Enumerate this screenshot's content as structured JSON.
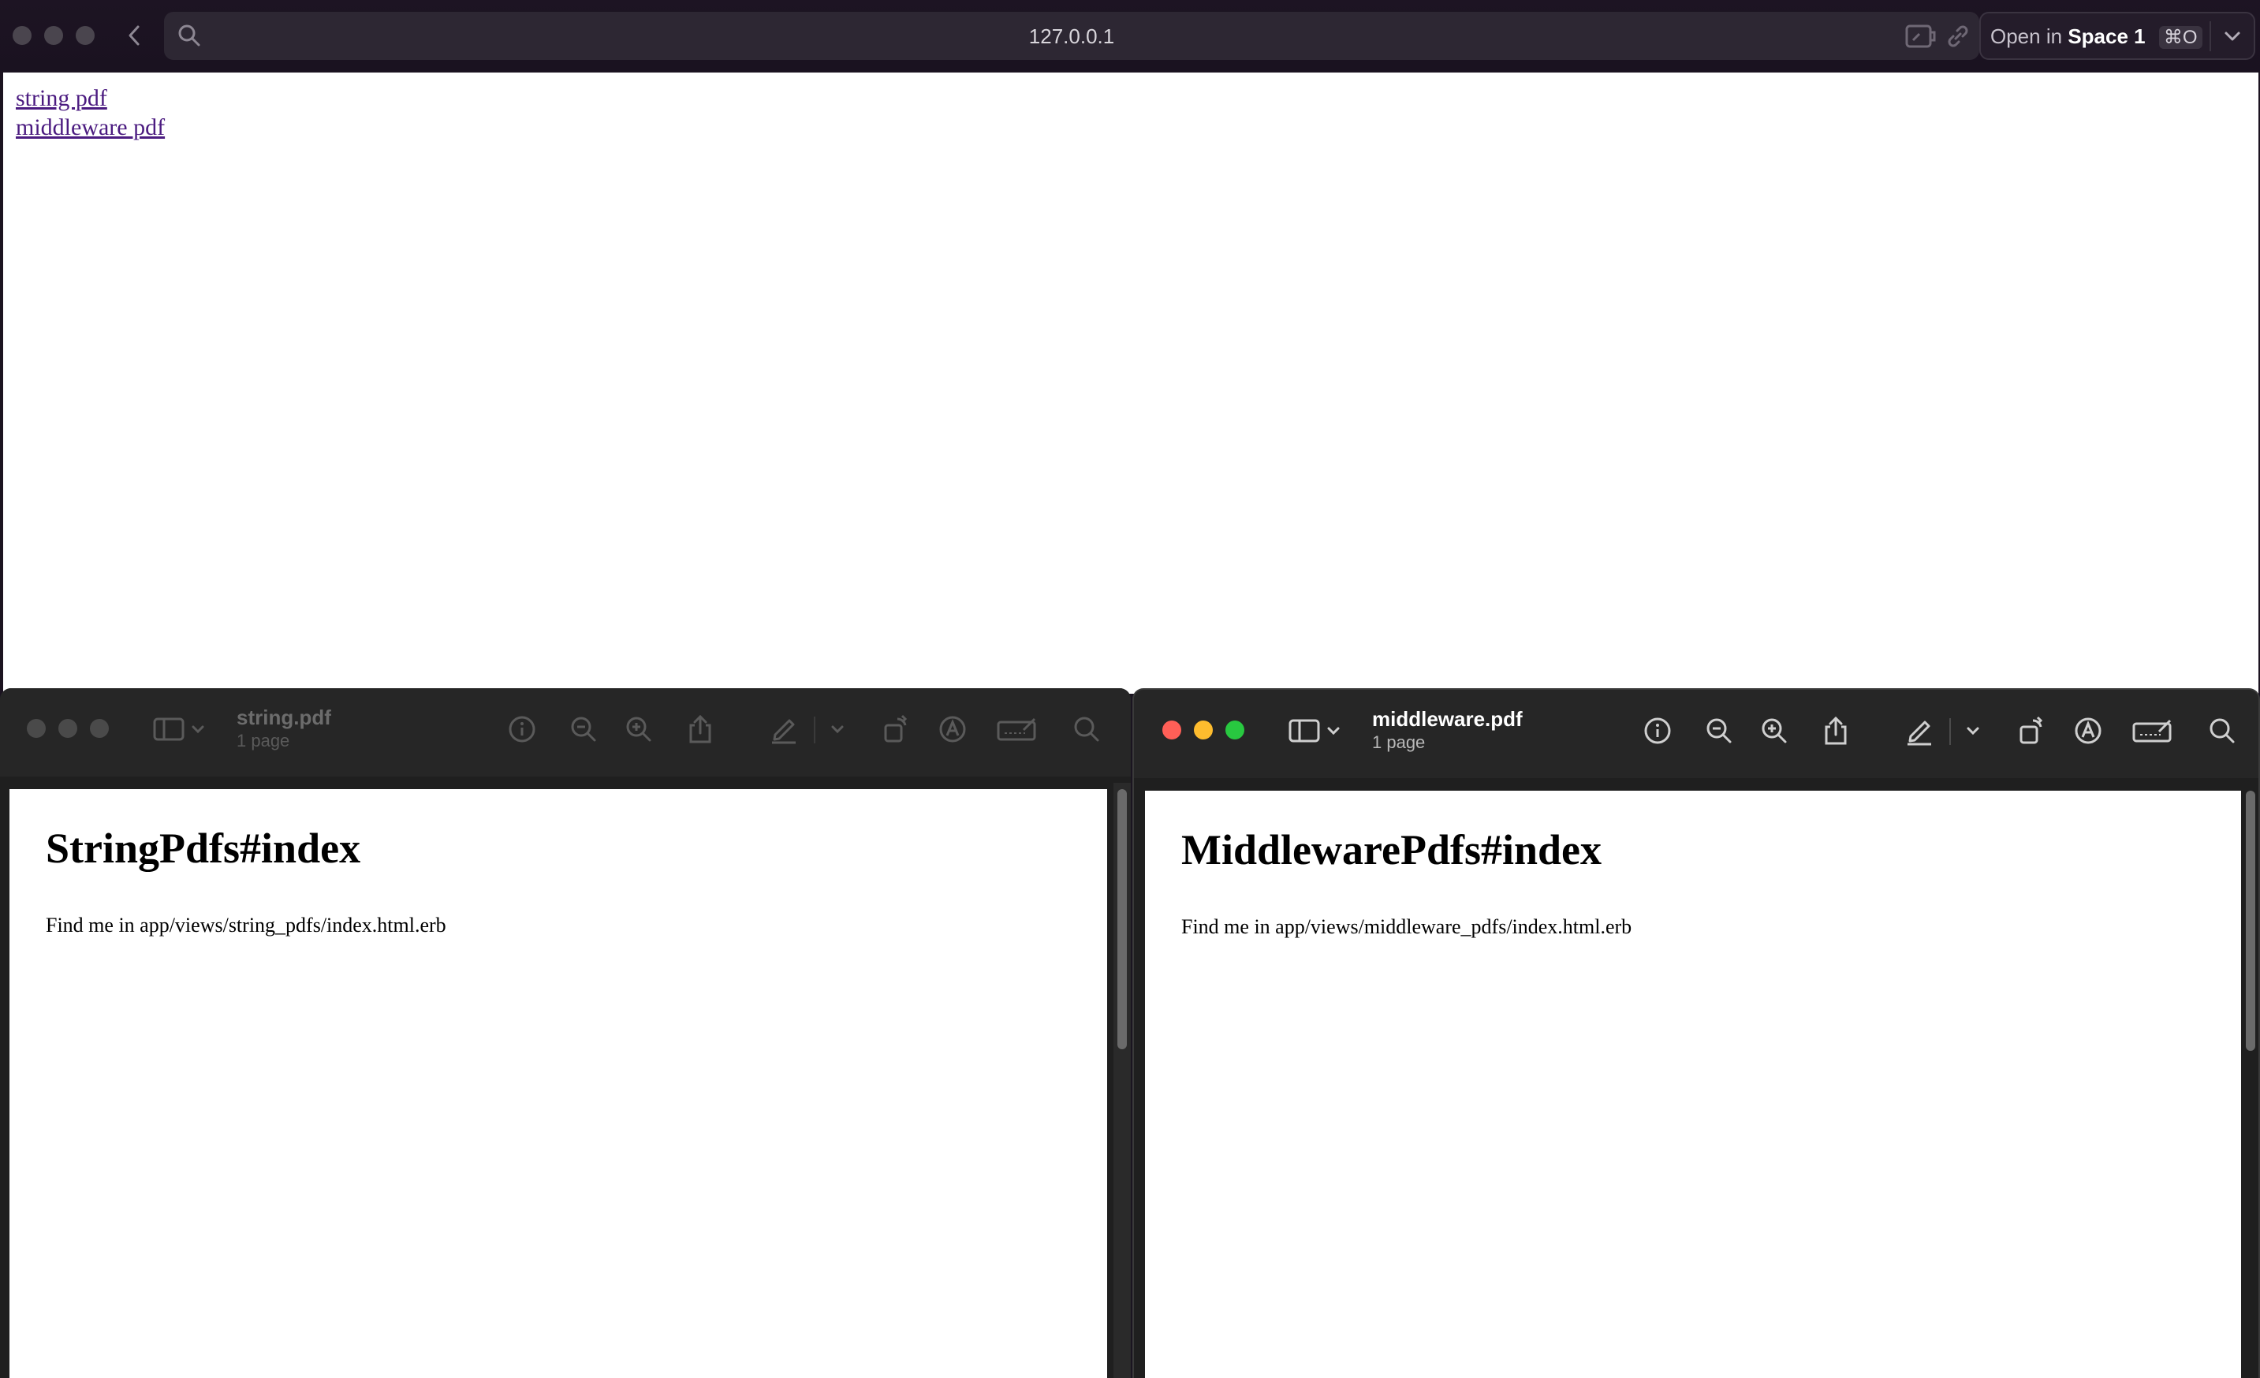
{
  "browser": {
    "url": "127.0.0.1",
    "open_in_space": {
      "prefix": "Open in",
      "space": "Space 1",
      "shortcut": "⌘O"
    },
    "page_links": [
      "string pdf",
      "middleware pdf"
    ]
  },
  "preview_string": {
    "title": "string.pdf",
    "subtitle": "1 page",
    "heading": "StringPdfs#index",
    "body": "Find me in app/views/string_pdfs/index.html.erb"
  },
  "preview_middleware": {
    "title": "middleware.pdf",
    "subtitle": "1 page",
    "heading": "MiddlewarePdfs#index",
    "body": "Find me in app/views/middleware_pdfs/index.html.erb"
  },
  "colors": {
    "traffic_close": "#ff5f57",
    "traffic_minimize": "#febc2e",
    "traffic_zoom": "#28c840",
    "link": "#4b1b80"
  }
}
